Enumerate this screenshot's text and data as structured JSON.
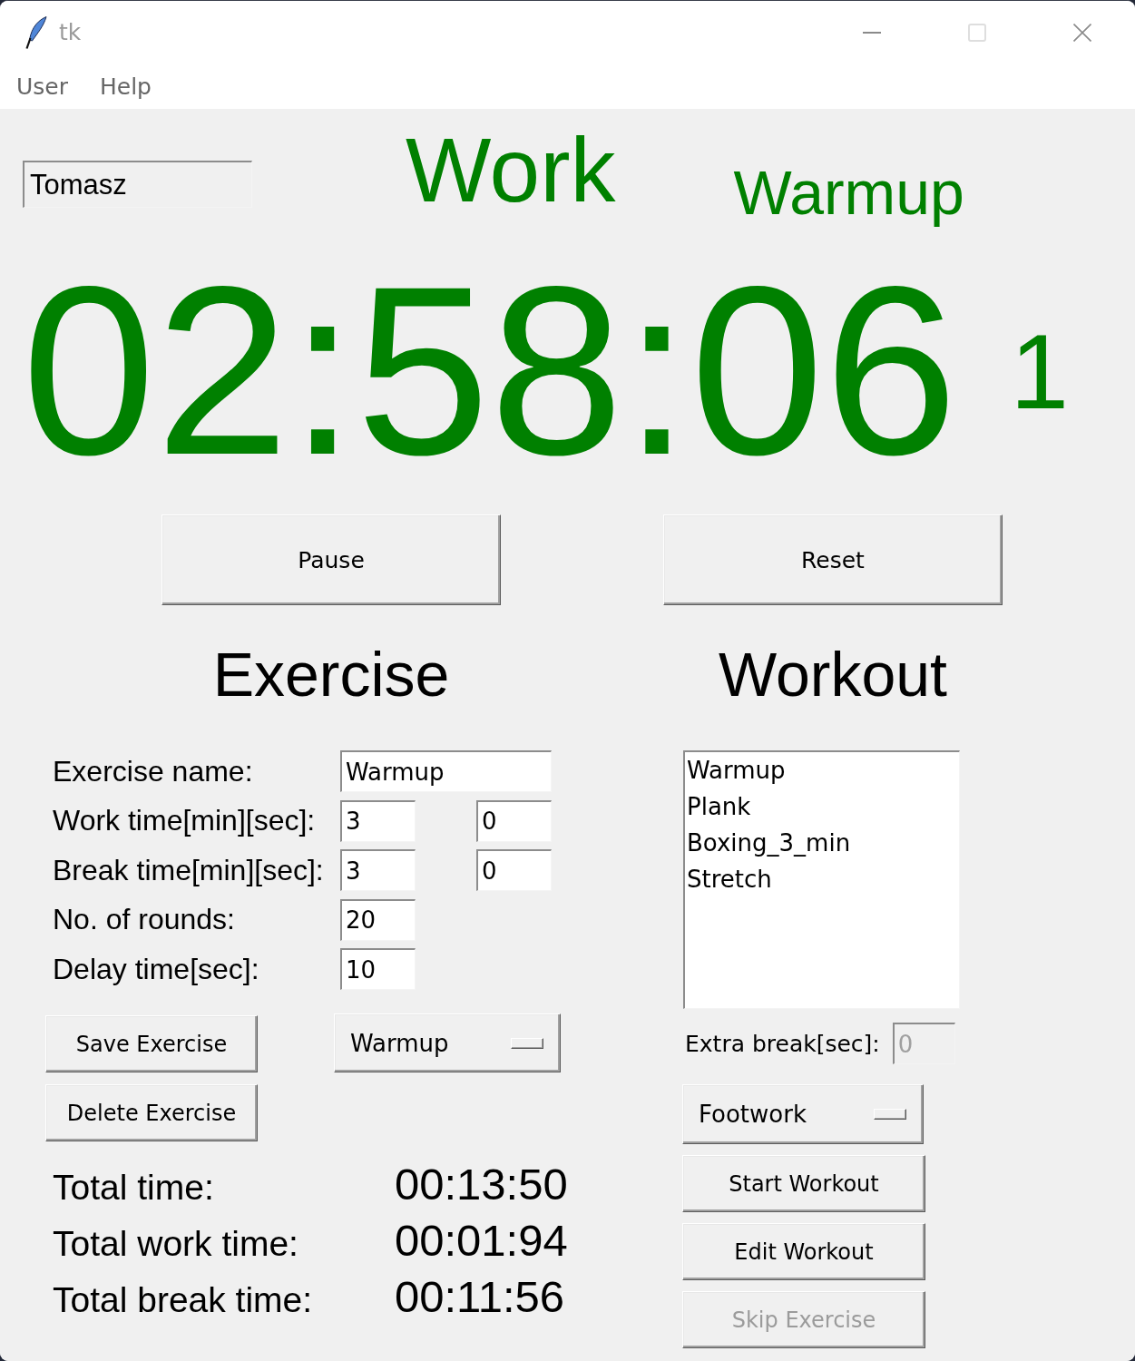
{
  "window": {
    "title": "tk",
    "maximize_disabled": true
  },
  "menu": [
    {
      "label": "User"
    },
    {
      "label": "Help"
    }
  ],
  "user_field": {
    "value": "Tomasz"
  },
  "status": {
    "phase": "Work",
    "exercise": "Warmup",
    "timer": "02:58:06",
    "round": "1"
  },
  "controls": [
    {
      "label": "Pause"
    },
    {
      "label": "Reset"
    }
  ],
  "exercise": {
    "heading": "Exercise",
    "fields": [
      {
        "label": "Exercise name:",
        "kind": "text",
        "values": [
          "Warmup"
        ]
      },
      {
        "label": "Work time[min][sec]:",
        "kind": "duration",
        "values": [
          "3",
          "0"
        ]
      },
      {
        "label": "Break time[min][sec]:",
        "kind": "duration",
        "values": [
          "3",
          "0"
        ]
      },
      {
        "label": "No. of rounds:",
        "kind": "number",
        "values": [
          "20"
        ]
      },
      {
        "label": "Delay time[sec]:",
        "kind": "number",
        "values": [
          "10"
        ]
      }
    ],
    "buttons": [
      {
        "label": "Save Exercise"
      },
      {
        "label": "Delete Exercise"
      }
    ],
    "dropdown": {
      "value": "Warmup"
    },
    "totals": [
      {
        "label": "Total time:",
        "value": "00:13:50"
      },
      {
        "label": "Total work time:",
        "value": "00:01:94"
      },
      {
        "label": "Total break time:",
        "value": "00:11:56"
      }
    ]
  },
  "workout": {
    "heading": "Workout",
    "list": [
      {
        "label": "Warmup",
        "selected": false
      },
      {
        "label": "Plank",
        "selected": false
      },
      {
        "label": "Boxing_3_min",
        "selected": false
      },
      {
        "label": "Stretch",
        "selected": false
      }
    ],
    "extra_break": {
      "label": "Extra break[sec]:",
      "value": "0",
      "disabled": true
    },
    "dropdown": {
      "value": "Footwork"
    },
    "buttons": [
      {
        "label": "Start Workout",
        "disabled": false
      },
      {
        "label": "Edit Workout",
        "disabled": false
      },
      {
        "label": "Skip Exercise",
        "disabled": true
      }
    ]
  }
}
